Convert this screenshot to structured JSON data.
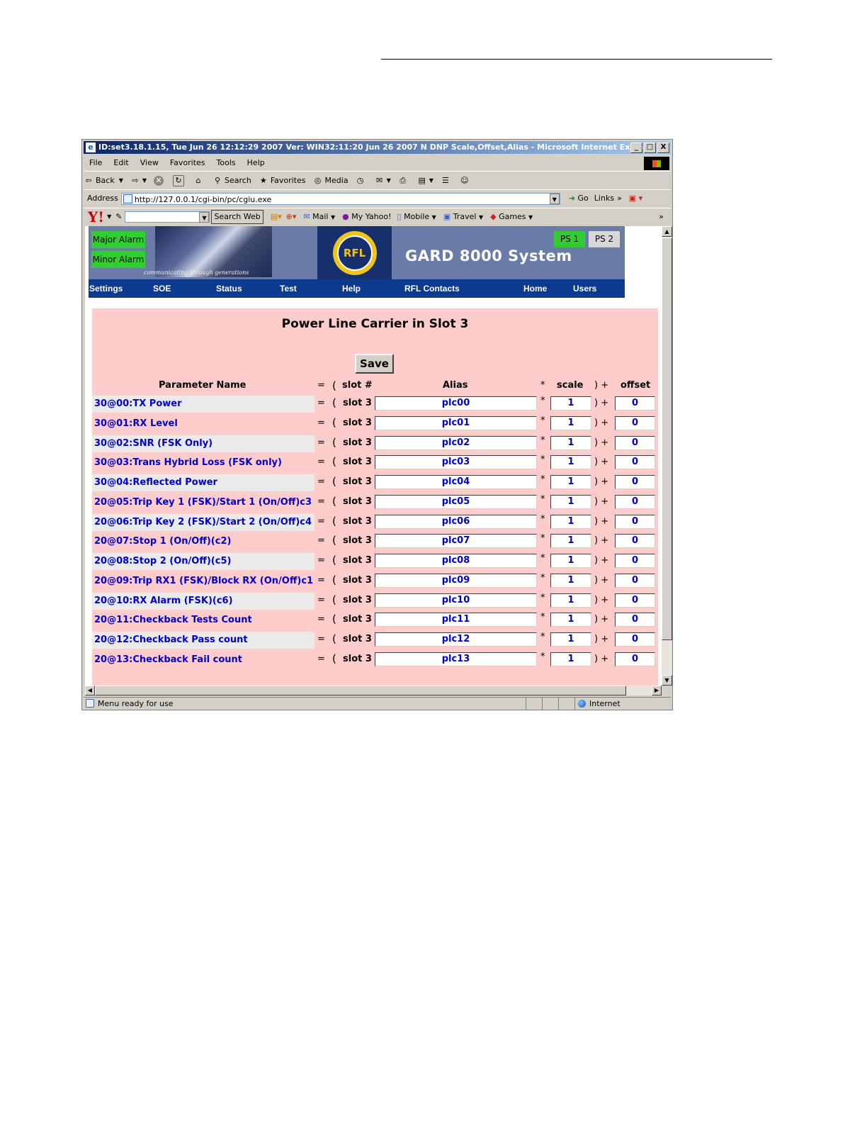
{
  "window": {
    "title": "ID:set3.18.1.15, Tue Jun 26 12:12:29 2007 Ver: WIN32:11:20 Jun 26 2007 N DNP Scale,Offset,Alias - Microsoft Internet Explorer",
    "buttons": [
      "_",
      "□",
      "X"
    ]
  },
  "menu": [
    "File",
    "Edit",
    "View",
    "Favorites",
    "Tools",
    "Help"
  ],
  "toolbar": {
    "back": "Back",
    "search": "Search",
    "favorites": "Favorites",
    "media": "Media"
  },
  "address": {
    "label": "Address",
    "url": "http://127.0.0.1/cgi-bin/pc/cgiu.exe",
    "go": "Go",
    "links": "Links"
  },
  "yahoo": {
    "logo": "Y!",
    "search_button": "Search Web",
    "mail": "Mail",
    "my_yahoo": "My Yahoo!",
    "mobile": "Mobile",
    "travel": "Travel",
    "games": "Games"
  },
  "banner": {
    "major_alarm": "Major Alarm",
    "minor_alarm": "Minor Alarm",
    "tagline": "communicating through generations",
    "logo_text": "RFL",
    "system_title": "GARD 8000 System",
    "ps1": "PS 1",
    "ps2": "PS 2",
    "colors": {
      "alarm": "#33cc33",
      "nav": "#0b3a8e",
      "banner": "#6b7ba8"
    }
  },
  "nav": [
    "Settings",
    "SOE",
    "Status",
    "Test",
    "Help",
    "RFL Contacts",
    "Home",
    "Users"
  ],
  "page": {
    "title": "Power Line Carrier in Slot 3",
    "save_label": "Save",
    "headers": {
      "name": "Parameter Name",
      "eq": "=",
      "open": "(",
      "slot": "slot #",
      "alias": "Alias",
      "mult": "*",
      "scale": "scale",
      "close": ") +",
      "offset": "offset"
    },
    "rows": [
      {
        "name": "30@00:TX Power",
        "slot": "slot 3",
        "alias": "plc00",
        "scale": "1",
        "offset": "0"
      },
      {
        "name": "30@01:RX Level",
        "slot": "slot 3",
        "alias": "plc01",
        "scale": "1",
        "offset": "0"
      },
      {
        "name": "30@02:SNR (FSK Only)",
        "slot": "slot 3",
        "alias": "plc02",
        "scale": "1",
        "offset": "0"
      },
      {
        "name": "30@03:Trans Hybrid Loss (FSK only)",
        "slot": "slot 3",
        "alias": "plc03",
        "scale": "1",
        "offset": "0"
      },
      {
        "name": "30@04:Reflected Power",
        "slot": "slot 3",
        "alias": "plc04",
        "scale": "1",
        "offset": "0"
      },
      {
        "name": "20@05:Trip Key 1 (FSK)/Start 1 (On/Off)c3",
        "slot": "slot 3",
        "alias": "plc05",
        "scale": "1",
        "offset": "0"
      },
      {
        "name": "20@06:Trip Key 2 (FSK)/Start 2 (On/Off)c4",
        "slot": "slot 3",
        "alias": "plc06",
        "scale": "1",
        "offset": "0"
      },
      {
        "name": "20@07:Stop 1 (On/Off)(c2)",
        "slot": "slot 3",
        "alias": "plc07",
        "scale": "1",
        "offset": "0"
      },
      {
        "name": "20@08:Stop 2 (On/Off)(c5)",
        "slot": "slot 3",
        "alias": "plc08",
        "scale": "1",
        "offset": "0"
      },
      {
        "name": "20@09:Trip RX1 (FSK)/Block RX (On/Off)c1",
        "slot": "slot 3",
        "alias": "plc09",
        "scale": "1",
        "offset": "0"
      },
      {
        "name": "20@10:RX Alarm (FSK)(c6)",
        "slot": "slot 3",
        "alias": "plc10",
        "scale": "1",
        "offset": "0"
      },
      {
        "name": "20@11:Checkback Tests Count",
        "slot": "slot 3",
        "alias": "plc11",
        "scale": "1",
        "offset": "0"
      },
      {
        "name": "20@12:Checkback Pass count",
        "slot": "slot 3",
        "alias": "plc12",
        "scale": "1",
        "offset": "0"
      },
      {
        "name": "20@13:Checkback Fail count",
        "slot": "slot 3",
        "alias": "plc13",
        "scale": "1",
        "offset": "0"
      }
    ]
  },
  "status": {
    "text": "Menu ready for use",
    "zone": "Internet"
  }
}
